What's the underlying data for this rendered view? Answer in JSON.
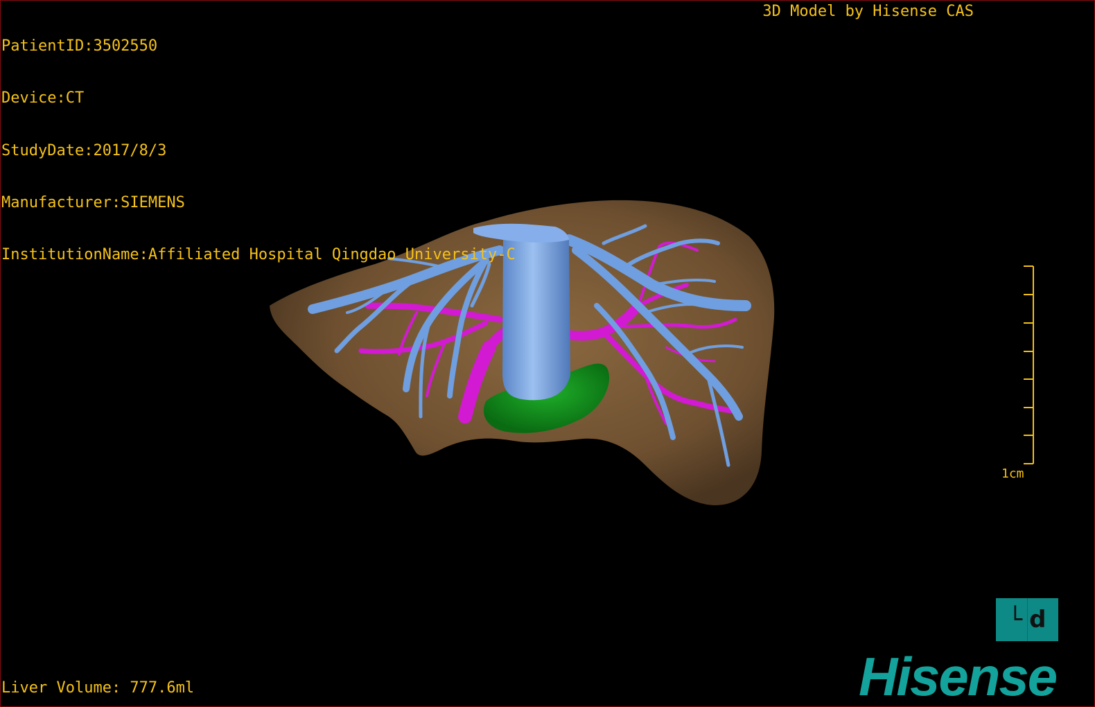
{
  "patient_info": {
    "patient_id": "PatientID:3502550",
    "device": "Device:CT",
    "study_date": "StudyDate:2017/8/3",
    "manufacturer": "Manufacturer:SIEMENS",
    "institution": "InstitutionName:Affiliated Hospital Qingdao University-C"
  },
  "credit": "3D Model by Hisense CAS",
  "liver_volume": "Liver Volume: 777.6ml",
  "scale": {
    "label": "1cm"
  },
  "orientation_cube": {
    "left_glyph": "└",
    "right_glyph": "d"
  },
  "logo": "Hisense",
  "colors": {
    "text": "#f5c21a",
    "liver": "#7a5a36",
    "hepatic_veins": "#6f9fe0",
    "portal_vein": "#d21ad2",
    "gallbladder": "#0f8f1a",
    "logo": "#14a39c",
    "border": "#8b0d12"
  }
}
